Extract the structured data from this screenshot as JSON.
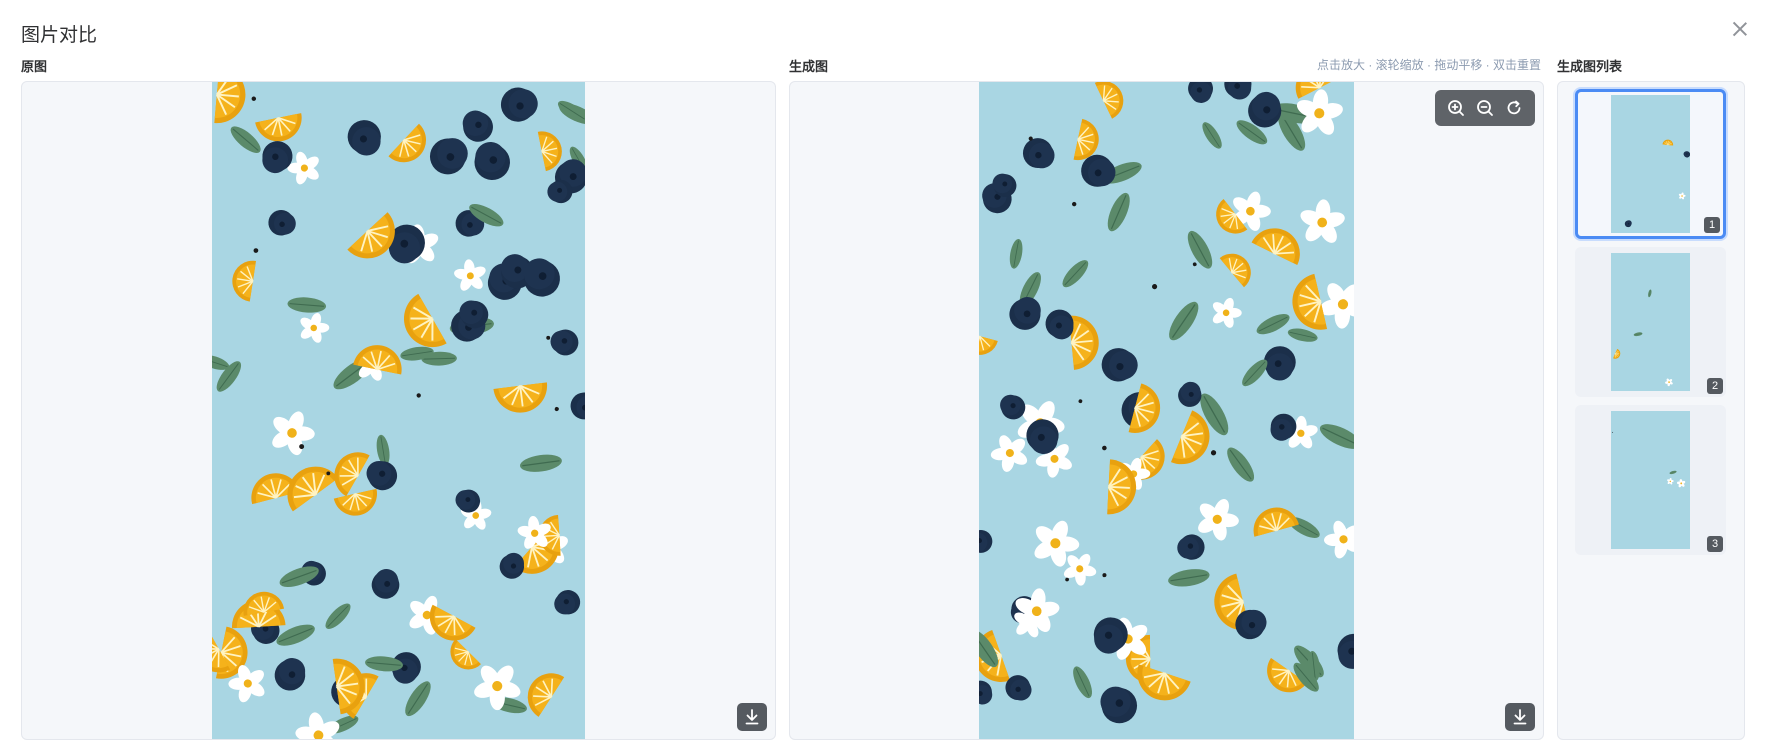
{
  "dialog": {
    "title": "图片对比"
  },
  "original": {
    "label": "原图"
  },
  "generated": {
    "label": "生成图",
    "hint": "点击放大 · 滚轮缩放 · 拖动平移 · 双击重置"
  },
  "list": {
    "label": "生成图列表",
    "items": [
      {
        "index": "1",
        "active": true
      },
      {
        "index": "2",
        "active": false
      },
      {
        "index": "3",
        "active": false
      }
    ]
  },
  "icons": {
    "close": "close-icon",
    "zoom_in": "zoom-in-icon",
    "zoom_out": "zoom-out-icon",
    "reset": "reset-icon",
    "download": "download-icon"
  },
  "colors": {
    "pattern_bg": "#a9d6e3",
    "lemon": "#f5b21b",
    "blueberry": "#1e3350",
    "leaf": "#5b8a6a",
    "flower": "#ffffff",
    "active_border": "#4b8bf4"
  }
}
